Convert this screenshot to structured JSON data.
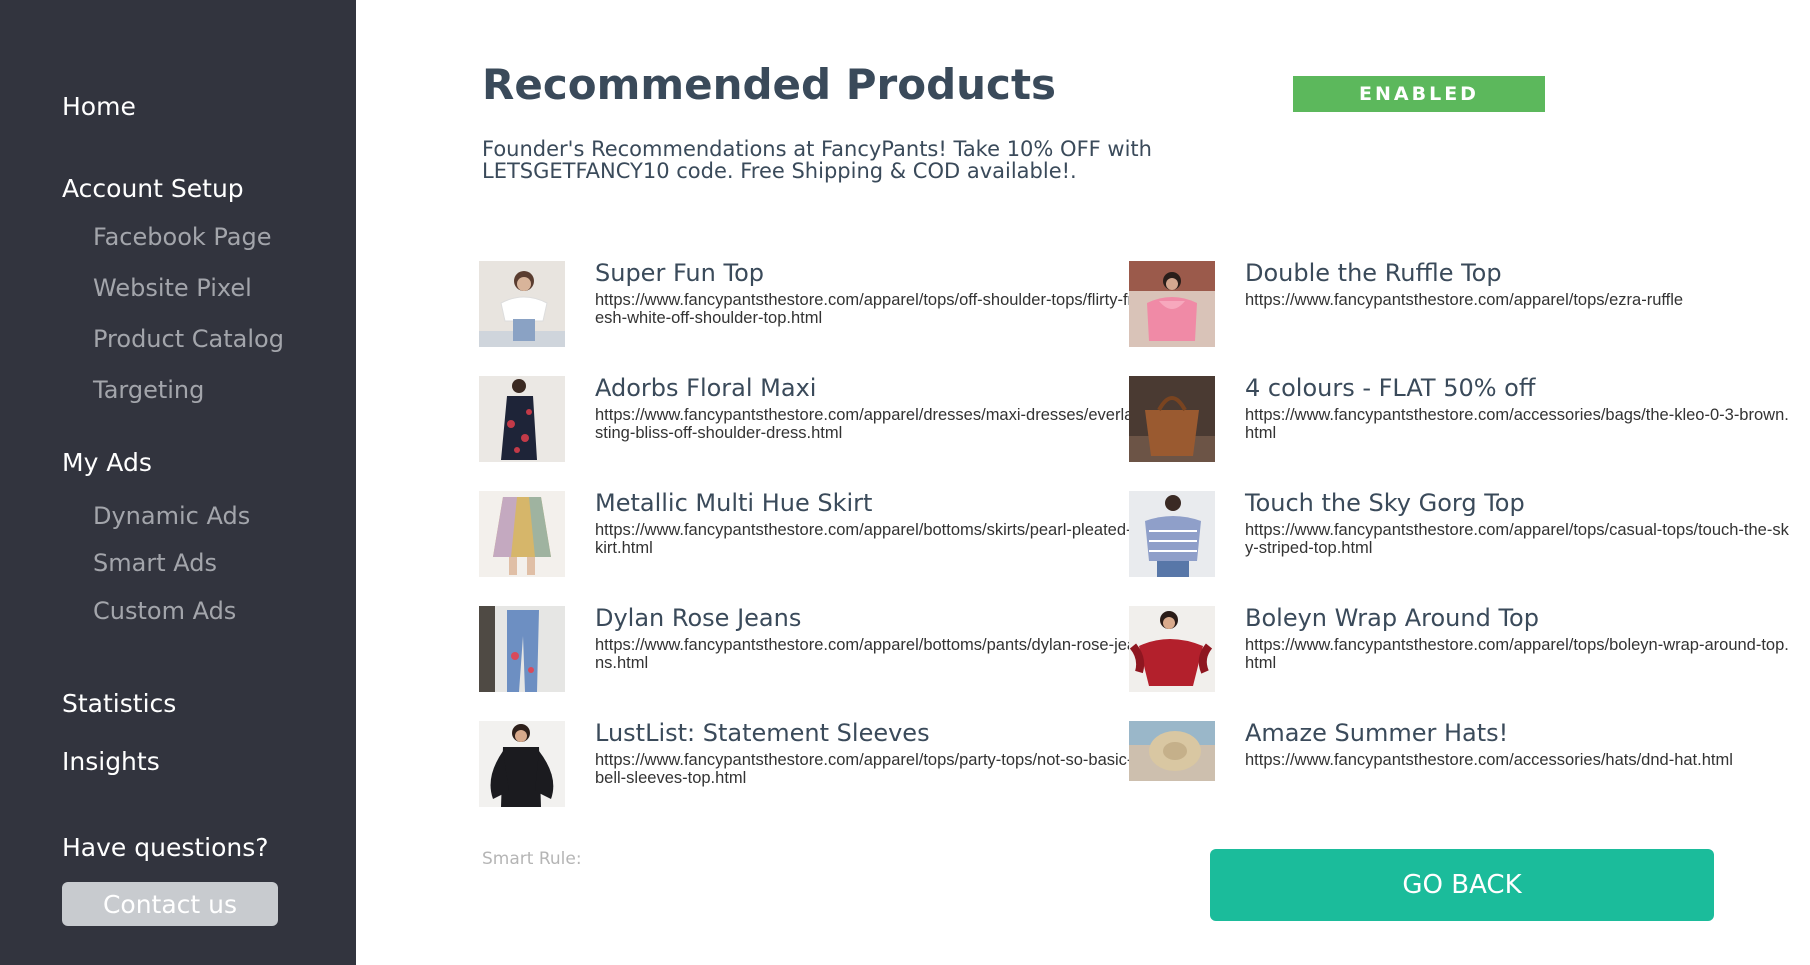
{
  "sidebar": {
    "home": "Home",
    "account_setup": "Account Setup",
    "facebook_page": "Facebook Page",
    "website_pixel": "Website Pixel",
    "product_catalog": "Product Catalog",
    "targeting": "Targeting",
    "my_ads": "My Ads",
    "dynamic_ads": "Dynamic Ads",
    "smart_ads": "Smart Ads",
    "custom_ads": "Custom Ads",
    "statistics": "Statistics",
    "insights": "Insights",
    "questions": "Have questions?",
    "contact_button": "Contact us"
  },
  "main": {
    "title": "Recommended Products",
    "status": "ENABLED",
    "description": "Founder's Recommendations at FancyPants! Take 10% OFF with LETSGETFANCY10 code. Free Shipping & COD available!.",
    "smart_rule_label": "Smart Rule:",
    "go_back_button": "GO BACK"
  },
  "products": [
    {
      "name": "Super Fun Top",
      "url": "https://www.fancypantsthestore.com/apparel/tops/off-shoulder-tops/flirty-fresh-white-off-shoulder-top.html"
    },
    {
      "name": "Double the Ruffle Top",
      "url": "https://www.fancypantsthestore.com/apparel/tops/ezra-ruffle"
    },
    {
      "name": "Adorbs Floral Maxi",
      "url": "https://www.fancypantsthestore.com/apparel/dresses/maxi-dresses/everlasting-bliss-off-shoulder-dress.html"
    },
    {
      "name": "4 colours - FLAT 50% off",
      "url": "https://www.fancypantsthestore.com/accessories/bags/the-kleo-0-3-brown.html"
    },
    {
      "name": "Metallic Multi Hue Skirt",
      "url": "https://www.fancypantsthestore.com/apparel/bottoms/skirts/pearl-pleated-skirt.html"
    },
    {
      "name": "Touch the Sky Gorg Top",
      "url": "https://www.fancypantsthestore.com/apparel/tops/casual-tops/touch-the-sky-striped-top.html"
    },
    {
      "name": "Dylan Rose Jeans",
      "url": "https://www.fancypantsthestore.com/apparel/bottoms/pants/dylan-rose-jeans.html"
    },
    {
      "name": "Boleyn Wrap Around Top",
      "url": "https://www.fancypantsthestore.com/apparel/tops/boleyn-wrap-around-top.html"
    },
    {
      "name": "LustList: Statement Sleeves",
      "url": "https://www.fancypantsthestore.com/apparel/tops/party-tops/not-so-basic-bell-sleeves-top.html"
    },
    {
      "name": "Amaze Summer Hats!",
      "url": "https://www.fancypantsthestore.com/accessories/hats/dnd-hat.html"
    }
  ],
  "colors": {
    "sidebar_bg": "#32343e",
    "enabled_badge": "#5cb85c",
    "go_back_button": "#1bbc9b",
    "contact_button": "#c8cbcf"
  }
}
